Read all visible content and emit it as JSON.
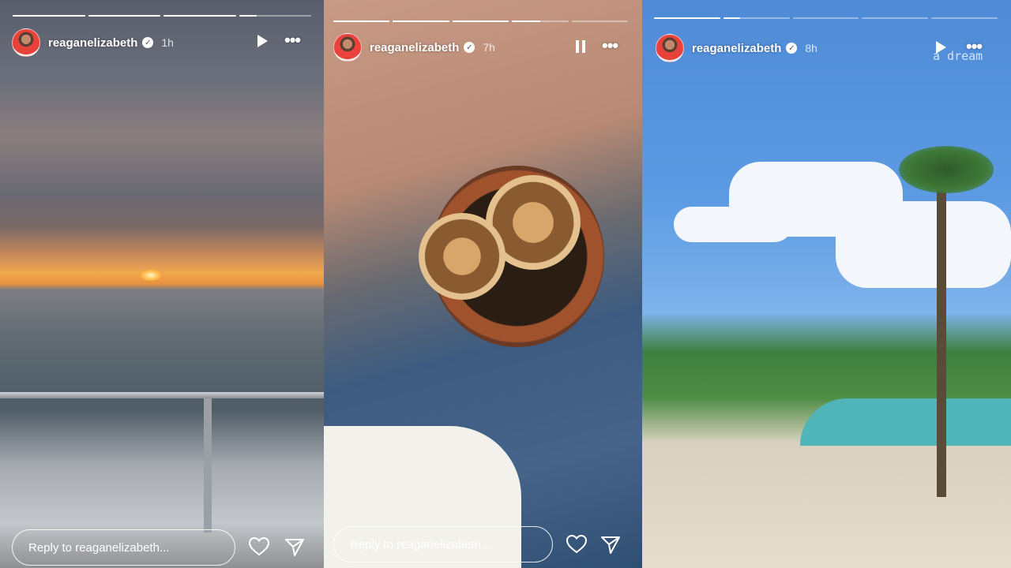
{
  "stories": [
    {
      "username": "reaganelizabeth",
      "time": "1h",
      "control_icon": "play-icon",
      "reply_placeholder": "Reply to reaganelizabeth...",
      "progress": [
        1,
        1,
        1,
        0.25
      ]
    },
    {
      "username": "reaganelizabeth",
      "time": "7h",
      "control_icon": "pause-icon",
      "reply_placeholder": "Reply to reaganelizabeth...",
      "progress": [
        1,
        1,
        1,
        0.5,
        0
      ]
    },
    {
      "username": "reaganelizabeth",
      "time": "8h",
      "control_icon": "play-icon",
      "overlay_text": "a dream",
      "progress": [
        1,
        0.25,
        0,
        0,
        0
      ]
    }
  ]
}
